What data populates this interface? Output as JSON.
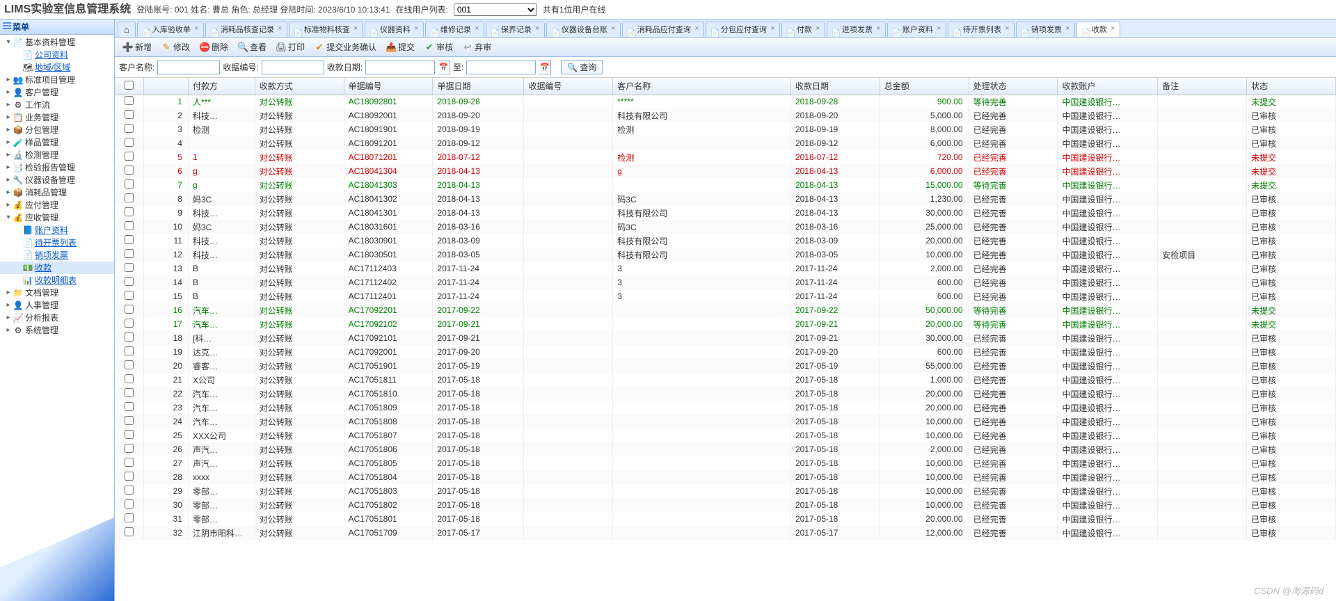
{
  "header": {
    "system_name": "LIMS实验室信息管理系统",
    "login_prefix": "登陆账号:",
    "login_acct": "001",
    "name_prefix": "姓名:",
    "name": "曹总",
    "role_prefix": "角色:",
    "role": "总经理",
    "time_prefix": "登陆时间:",
    "time": "2023/6/10 10:13:41",
    "online_prefix": "在线用户列表:",
    "online_value": "001",
    "online_suffix": "共有1位用户在线"
  },
  "sidebar": {
    "title": "菜单",
    "nodes": [
      {
        "depth": 0,
        "exp": "▾",
        "icon": "📄",
        "label": "基本资料管理",
        "link": false
      },
      {
        "depth": 1,
        "exp": "",
        "icon": "📄",
        "label": "公司资料",
        "link": true
      },
      {
        "depth": 1,
        "exp": "",
        "icon": "🗺",
        "label": "地域/区域",
        "link": true
      },
      {
        "depth": 0,
        "exp": "▸",
        "icon": "👥",
        "label": "标准项目管理",
        "link": false
      },
      {
        "depth": 0,
        "exp": "▸",
        "icon": "👤",
        "label": "客户管理",
        "link": false
      },
      {
        "depth": 0,
        "exp": "▸",
        "icon": "⚙",
        "label": "工作流",
        "link": false
      },
      {
        "depth": 0,
        "exp": "▸",
        "icon": "📋",
        "label": "业务管理",
        "link": false
      },
      {
        "depth": 0,
        "exp": "▸",
        "icon": "📦",
        "label": "分包管理",
        "link": false
      },
      {
        "depth": 0,
        "exp": "▸",
        "icon": "🧪",
        "label": "样品管理",
        "link": false
      },
      {
        "depth": 0,
        "exp": "▸",
        "icon": "🔬",
        "label": "检测管理",
        "link": false
      },
      {
        "depth": 0,
        "exp": "▸",
        "icon": "📑",
        "label": "检验报告管理",
        "link": false
      },
      {
        "depth": 0,
        "exp": "▸",
        "icon": "🔧",
        "label": "仪器设备管理",
        "link": false
      },
      {
        "depth": 0,
        "exp": "▸",
        "icon": "📦",
        "label": "消耗品管理",
        "link": false
      },
      {
        "depth": 0,
        "exp": "▸",
        "icon": "💰",
        "label": "应付管理",
        "link": false
      },
      {
        "depth": 0,
        "exp": "▾",
        "icon": "💰",
        "label": "应收管理",
        "link": false
      },
      {
        "depth": 1,
        "exp": "",
        "icon": "📘",
        "label": "账户资料",
        "link": true
      },
      {
        "depth": 1,
        "exp": "",
        "icon": "📄",
        "label": "待开票列表",
        "link": true
      },
      {
        "depth": 1,
        "exp": "",
        "icon": "📄",
        "label": "销项发票",
        "link": true
      },
      {
        "depth": 1,
        "exp": "",
        "icon": "💵",
        "label": "收款",
        "link": true,
        "selected": true
      },
      {
        "depth": 1,
        "exp": "",
        "icon": "📊",
        "label": "收款明细表",
        "link": true
      },
      {
        "depth": 0,
        "exp": "▸",
        "icon": "📁",
        "label": "文档管理",
        "link": false
      },
      {
        "depth": 0,
        "exp": "▸",
        "icon": "👤",
        "label": "人事管理",
        "link": false
      },
      {
        "depth": 0,
        "exp": "▸",
        "icon": "📈",
        "label": "分析报表",
        "link": false
      },
      {
        "depth": 0,
        "exp": "▸",
        "icon": "⚙",
        "label": "系统管理",
        "link": false
      }
    ]
  },
  "tabs": [
    {
      "label": "",
      "home": true
    },
    {
      "label": "入库验收单"
    },
    {
      "label": "消耗品核查记录"
    },
    {
      "label": "标准物料核查"
    },
    {
      "label": "仪器资料"
    },
    {
      "label": "维修记录"
    },
    {
      "label": "保养记录"
    },
    {
      "label": "仪器设备台账"
    },
    {
      "label": "消耗品应付查询"
    },
    {
      "label": "分包应付查询"
    },
    {
      "label": "付款"
    },
    {
      "label": "进项发票"
    },
    {
      "label": "账户资料"
    },
    {
      "label": "待开票列表"
    },
    {
      "label": "销项发票"
    },
    {
      "label": "收款",
      "active": true
    }
  ],
  "toolbar": [
    {
      "icon": "➕",
      "color": "#2a9d2a",
      "label": "新增"
    },
    {
      "icon": "✎",
      "color": "#d08a00",
      "label": "修改"
    },
    {
      "icon": "⛔",
      "color": "#d02a2a",
      "label": "删除"
    },
    {
      "icon": "🔍",
      "color": "#555",
      "label": "查看"
    },
    {
      "icon": "🖨",
      "color": "#555",
      "label": "打印"
    },
    {
      "icon": "✔",
      "color": "#d08a00",
      "label": "提交业务确认"
    },
    {
      "icon": "📤",
      "color": "#3a78c8",
      "label": "提交"
    },
    {
      "icon": "✔",
      "color": "#2a9d2a",
      "label": "审核"
    },
    {
      "icon": "↩",
      "color": "#888",
      "label": "弃审"
    }
  ],
  "search": {
    "cust_label": "客户名称:",
    "recv_no_label": "收据编号:",
    "recv_date_label": "收款日期:",
    "to_label": "至:",
    "query_label": "查询"
  },
  "columns": [
    "",
    "",
    "付款方",
    "收款方式",
    "单据编号",
    "单据日期",
    "收据编号",
    "客户名称",
    "收款日期",
    "总金额",
    "处理状态",
    "收款账户",
    "备注",
    "状态"
  ],
  "rows": [
    {
      "n": 1,
      "payer": "人***",
      "col3": "",
      "method": "对公转账",
      "no": "AC18092801",
      "ddate": "2018-09-28",
      "rno": "",
      "cust": "*****",
      "rdate": "2018-09-28",
      "amt": "900.00",
      "proc": "等待完善",
      "acct": "中国建设银行…",
      "note": "",
      "stat": "未提交",
      "cls": "green"
    },
    {
      "n": 2,
      "payer": "",
      "col3": "科技…",
      "method": "对公转账",
      "no": "AC18092001",
      "ddate": "2018-09-20",
      "rno": "",
      "cust": "科技有限公司",
      "rdate": "2018-09-20",
      "amt": "5,000.00",
      "proc": "已经完善",
      "acct": "中国建设银行…",
      "note": "",
      "stat": "已审核",
      "cls": ""
    },
    {
      "n": 3,
      "payer": "",
      "col3": "检测",
      "method": "对公转账",
      "no": "AC18091901",
      "ddate": "2018-09-19",
      "rno": "",
      "cust": "检测",
      "rdate": "2018-09-19",
      "amt": "8,000.00",
      "proc": "已经完善",
      "acct": "中国建设银行…",
      "note": "",
      "stat": "已审核",
      "cls": ""
    },
    {
      "n": 4,
      "payer": "",
      "col3": "",
      "method": "对公转账",
      "no": "AC18091201",
      "ddate": "2018-09-12",
      "rno": "",
      "cust": "",
      "rdate": "2018-09-12",
      "amt": "6,000.00",
      "proc": "已经完善",
      "acct": "中国建设银行…",
      "note": "",
      "stat": "已审核",
      "cls": ""
    },
    {
      "n": 5,
      "payer": "1",
      "col3": "",
      "method": "对公转账",
      "no": "AC18071201",
      "ddate": "2018-07-12",
      "rno": "",
      "cust": "检测",
      "rdate": "2018-07-12",
      "amt": "720.00",
      "proc": "已经完善",
      "acct": "中国建设银行…",
      "note": "",
      "stat": "未提交",
      "cls": "red"
    },
    {
      "n": 6,
      "payer": "",
      "col3": "g",
      "method": "对公转账",
      "no": "AC18041304",
      "ddate": "2018-04-13",
      "rno": "",
      "cust": "g",
      "rdate": "2018-04-13",
      "amt": "6,000.00",
      "proc": "已经完善",
      "acct": "中国建设银行…",
      "note": "",
      "stat": "未提交",
      "cls": "red"
    },
    {
      "n": 7,
      "payer": "",
      "col3": "g",
      "method": "对公转账",
      "no": "AC18041303",
      "ddate": "2018-04-13",
      "rno": "",
      "cust": "",
      "rdate": "2018-04-13",
      "amt": "15,000.00",
      "proc": "等待完善",
      "acct": "中国建设银行…",
      "note": "",
      "stat": "未提交",
      "cls": "green"
    },
    {
      "n": 8,
      "payer": "",
      "col3": "妈3C",
      "method": "对公转账",
      "no": "AC18041302",
      "ddate": "2018-04-13",
      "rno": "",
      "cust": "码3C",
      "rdate": "2018-04-13",
      "amt": "1,230.00",
      "proc": "已经完善",
      "acct": "中国建设银行…",
      "note": "",
      "stat": "已审核",
      "cls": ""
    },
    {
      "n": 9,
      "payer": "",
      "col3": "科技…",
      "method": "对公转账",
      "no": "AC18041301",
      "ddate": "2018-04-13",
      "rno": "",
      "cust": "科技有限公司",
      "rdate": "2018-04-13",
      "amt": "30,000.00",
      "proc": "已经完善",
      "acct": "中国建设银行…",
      "note": "",
      "stat": "已审核",
      "cls": ""
    },
    {
      "n": 10,
      "payer": "",
      "col3": "妈3C",
      "method": "对公转账",
      "no": "AC18031601",
      "ddate": "2018-03-16",
      "rno": "",
      "cust": "码3C",
      "rdate": "2018-03-16",
      "amt": "25,000.00",
      "proc": "已经完善",
      "acct": "中国建设银行…",
      "note": "",
      "stat": "已审核",
      "cls": ""
    },
    {
      "n": 11,
      "payer": "",
      "col3": "科技…",
      "method": "对公转账",
      "no": "AC18030901",
      "ddate": "2018-03-09",
      "rno": "",
      "cust": "科技有限公司",
      "rdate": "2018-03-09",
      "amt": "20,000.00",
      "proc": "已经完善",
      "acct": "中国建设银行…",
      "note": "",
      "stat": "已审核",
      "cls": ""
    },
    {
      "n": 12,
      "payer": "",
      "col3": "科技…",
      "method": "对公转账",
      "no": "AC18030501",
      "ddate": "2018-03-05",
      "rno": "",
      "cust": "科技有限公司",
      "rdate": "2018-03-05",
      "amt": "10,000.00",
      "proc": "已经完善",
      "acct": "中国建设银行…",
      "note": "安检项目",
      "stat": "已审核",
      "cls": ""
    },
    {
      "n": 13,
      "payer": "",
      "col3": "B",
      "method": "对公转账",
      "no": "AC17112403",
      "ddate": "2017-11-24",
      "rno": "",
      "cust": "3",
      "rdate": "2017-11-24",
      "amt": "2,000.00",
      "proc": "已经完善",
      "acct": "中国建设银行…",
      "note": "",
      "stat": "已审核",
      "cls": ""
    },
    {
      "n": 14,
      "payer": "",
      "col3": "B",
      "method": "对公转账",
      "no": "AC17112402",
      "ddate": "2017-11-24",
      "rno": "",
      "cust": "3",
      "rdate": "2017-11-24",
      "amt": "600.00",
      "proc": "已经完善",
      "acct": "中国建设银行…",
      "note": "",
      "stat": "已审核",
      "cls": ""
    },
    {
      "n": 15,
      "payer": "",
      "col3": "B",
      "method": "对公转账",
      "no": "AC17112401",
      "ddate": "2017-11-24",
      "rno": "",
      "cust": "3",
      "rdate": "2017-11-24",
      "amt": "600.00",
      "proc": "已经完善",
      "acct": "中国建设银行…",
      "note": "",
      "stat": "已审核",
      "cls": ""
    },
    {
      "n": 16,
      "payer": "",
      "col3": "汽车…",
      "method": "对公转账",
      "no": "AC17092201",
      "ddate": "2017-09-22",
      "rno": "",
      "cust": "",
      "rdate": "2017-09-22",
      "amt": "50,000.00",
      "proc": "等待完善",
      "acct": "中国建设银行…",
      "note": "",
      "stat": "未提交",
      "cls": "green"
    },
    {
      "n": 17,
      "payer": "",
      "col3": "汽车…",
      "method": "对公转账",
      "no": "AC17092102",
      "ddate": "2017-09-21",
      "rno": "",
      "cust": "",
      "rdate": "2017-09-21",
      "amt": "20,000.00",
      "proc": "等待完善",
      "acct": "中国建设银行…",
      "note": "",
      "stat": "未提交",
      "cls": "green"
    },
    {
      "n": 18,
      "payer": "",
      "col3": "[科…",
      "method": "对公转账",
      "no": "AC17092101",
      "ddate": "2017-09-21",
      "rno": "",
      "cust": "",
      "rdate": "2017-09-21",
      "amt": "30,000.00",
      "proc": "已经完善",
      "acct": "中国建设银行…",
      "note": "",
      "stat": "已审核",
      "cls": ""
    },
    {
      "n": 19,
      "payer": "",
      "col3": "达克…",
      "method": "对公转账",
      "no": "AC17092001",
      "ddate": "2017-09-20",
      "rno": "",
      "cust": "",
      "rdate": "2017-09-20",
      "amt": "600.00",
      "proc": "已经完善",
      "acct": "中国建设银行…",
      "note": "",
      "stat": "已审核",
      "cls": ""
    },
    {
      "n": 20,
      "payer": "",
      "col3": "睿客…",
      "method": "对公转账",
      "no": "AC17051901",
      "ddate": "2017-05-19",
      "rno": "",
      "cust": "",
      "rdate": "2017-05-19",
      "amt": "55,000.00",
      "proc": "已经完善",
      "acct": "中国建设银行…",
      "note": "",
      "stat": "已审核",
      "cls": ""
    },
    {
      "n": 21,
      "payer": "",
      "col3": "X公司",
      "method": "对公转账",
      "no": "AC17051811",
      "ddate": "2017-05-18",
      "rno": "",
      "cust": "",
      "rdate": "2017-05-18",
      "amt": "1,000.00",
      "proc": "已经完善",
      "acct": "中国建设银行…",
      "note": "",
      "stat": "已审核",
      "cls": ""
    },
    {
      "n": 22,
      "payer": "",
      "col3": "汽车…",
      "method": "对公转账",
      "no": "AC17051810",
      "ddate": "2017-05-18",
      "rno": "",
      "cust": "",
      "rdate": "2017-05-18",
      "amt": "20,000.00",
      "proc": "已经完善",
      "acct": "中国建设银行…",
      "note": "",
      "stat": "已审核",
      "cls": ""
    },
    {
      "n": 23,
      "payer": "",
      "col3": "汽车…",
      "method": "对公转账",
      "no": "AC17051809",
      "ddate": "2017-05-18",
      "rno": "",
      "cust": "",
      "rdate": "2017-05-18",
      "amt": "20,000.00",
      "proc": "已经完善",
      "acct": "中国建设银行…",
      "note": "",
      "stat": "已审核",
      "cls": ""
    },
    {
      "n": 24,
      "payer": "",
      "col3": "汽车…",
      "method": "对公转账",
      "no": "AC17051808",
      "ddate": "2017-05-18",
      "rno": "",
      "cust": "",
      "rdate": "2017-05-18",
      "amt": "10,000.00",
      "proc": "已经完善",
      "acct": "中国建设银行…",
      "note": "",
      "stat": "已审核",
      "cls": ""
    },
    {
      "n": 25,
      "payer": "",
      "col3": "XXX公司",
      "method": "对公转账",
      "no": "AC17051807",
      "ddate": "2017-05-18",
      "rno": "",
      "cust": "",
      "rdate": "2017-05-18",
      "amt": "10,000.00",
      "proc": "已经完善",
      "acct": "中国建设银行…",
      "note": "",
      "stat": "已审核",
      "cls": ""
    },
    {
      "n": 26,
      "payer": "",
      "col3": "声汽…",
      "method": "对公转账",
      "no": "AC17051806",
      "ddate": "2017-05-18",
      "rno": "",
      "cust": "",
      "rdate": "2017-05-18",
      "amt": "2,000.00",
      "proc": "已经完善",
      "acct": "中国建设银行…",
      "note": "",
      "stat": "已审核",
      "cls": ""
    },
    {
      "n": 27,
      "payer": "",
      "col3": "声汽…",
      "method": "对公转账",
      "no": "AC17051805",
      "ddate": "2017-05-18",
      "rno": "",
      "cust": "",
      "rdate": "2017-05-18",
      "amt": "10,000.00",
      "proc": "已经完善",
      "acct": "中国建设银行…",
      "note": "",
      "stat": "已审核",
      "cls": ""
    },
    {
      "n": 28,
      "payer": "",
      "col3": "xxxx",
      "method": "对公转账",
      "no": "AC17051804",
      "ddate": "2017-05-18",
      "rno": "",
      "cust": "",
      "rdate": "2017-05-18",
      "amt": "10,000.00",
      "proc": "已经完善",
      "acct": "中国建设银行…",
      "note": "",
      "stat": "已审核",
      "cls": ""
    },
    {
      "n": 29,
      "payer": "",
      "col3": "零部…",
      "method": "对公转账",
      "no": "AC17051803",
      "ddate": "2017-05-18",
      "rno": "",
      "cust": "",
      "rdate": "2017-05-18",
      "amt": "10,000.00",
      "proc": "已经完善",
      "acct": "中国建设银行…",
      "note": "",
      "stat": "已审核",
      "cls": ""
    },
    {
      "n": 30,
      "payer": "",
      "col3": "零部…",
      "method": "对公转账",
      "no": "AC17051802",
      "ddate": "2017-05-18",
      "rno": "",
      "cust": "",
      "rdate": "2017-05-18",
      "amt": "10,000.00",
      "proc": "已经完善",
      "acct": "中国建设银行…",
      "note": "",
      "stat": "已审核",
      "cls": ""
    },
    {
      "n": 31,
      "payer": "",
      "col3": "零部…",
      "method": "对公转账",
      "no": "AC17051801",
      "ddate": "2017-05-18",
      "rno": "",
      "cust": "",
      "rdate": "2017-05-18",
      "amt": "20,000.00",
      "proc": "已经完善",
      "acct": "中国建设银行…",
      "note": "",
      "stat": "已审核",
      "cls": ""
    },
    {
      "n": 32,
      "payer": "江阴市阳科…",
      "col3": "",
      "method": "对公转账",
      "no": "AC17051709",
      "ddate": "2017-05-17",
      "rno": "",
      "cust": "",
      "rdate": "2017-05-17",
      "amt": "12,000.00",
      "proc": "已经完善",
      "acct": "中国建设银行…",
      "note": "",
      "stat": "已审核",
      "cls": ""
    }
  ],
  "watermark": "CSDN @淘源码d"
}
